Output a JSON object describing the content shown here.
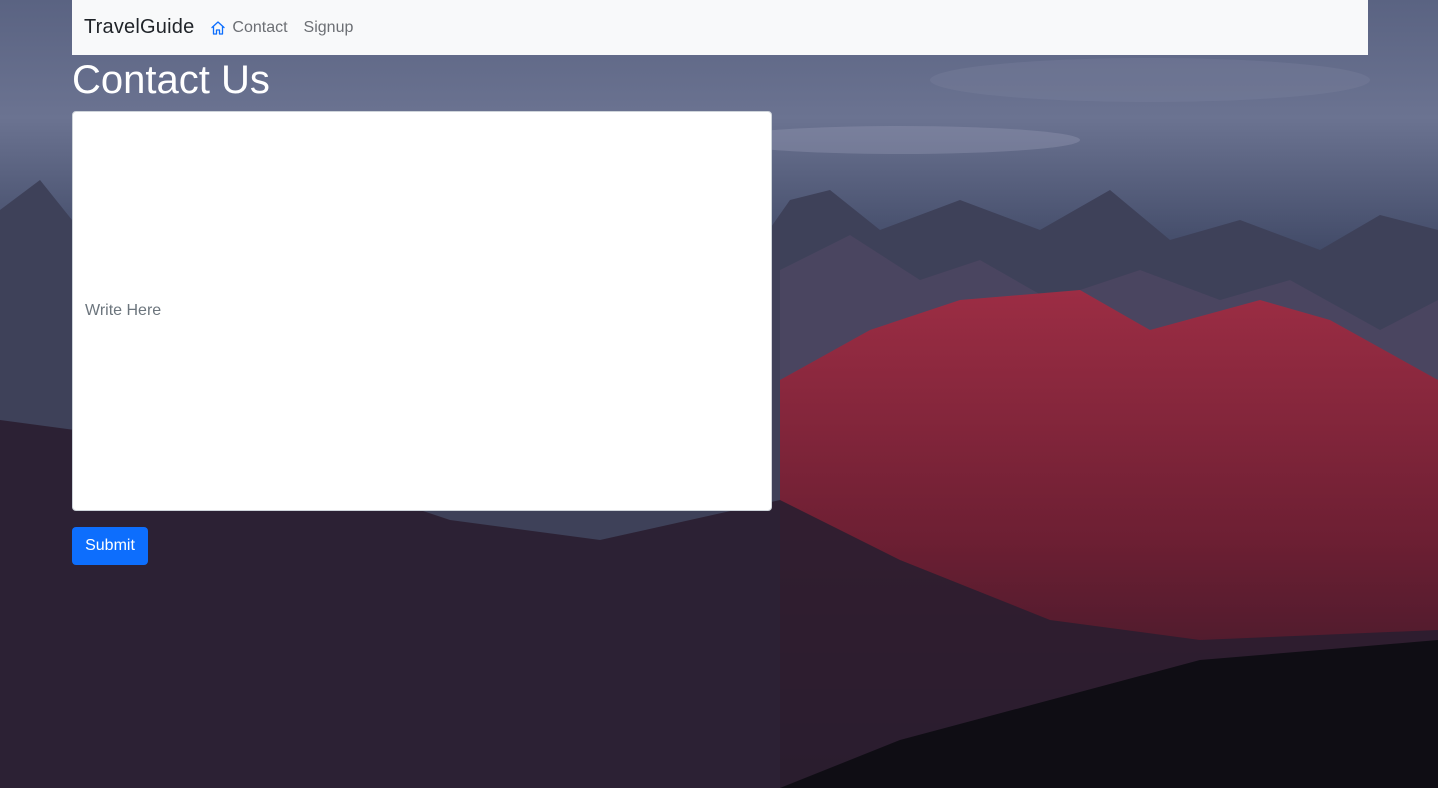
{
  "navbar": {
    "brand": "TravelGuide",
    "links": [
      {
        "label": "Contact",
        "icon": "home-icon"
      },
      {
        "label": "Signup"
      }
    ]
  },
  "page": {
    "title": "Contact Us"
  },
  "form": {
    "message_placeholder": "Write Here",
    "submit_label": "Submit"
  },
  "colors": {
    "navbar_bg": "#f8f9fa",
    "primary": "#0d6efd",
    "icon_accent": "#0d6efd"
  }
}
